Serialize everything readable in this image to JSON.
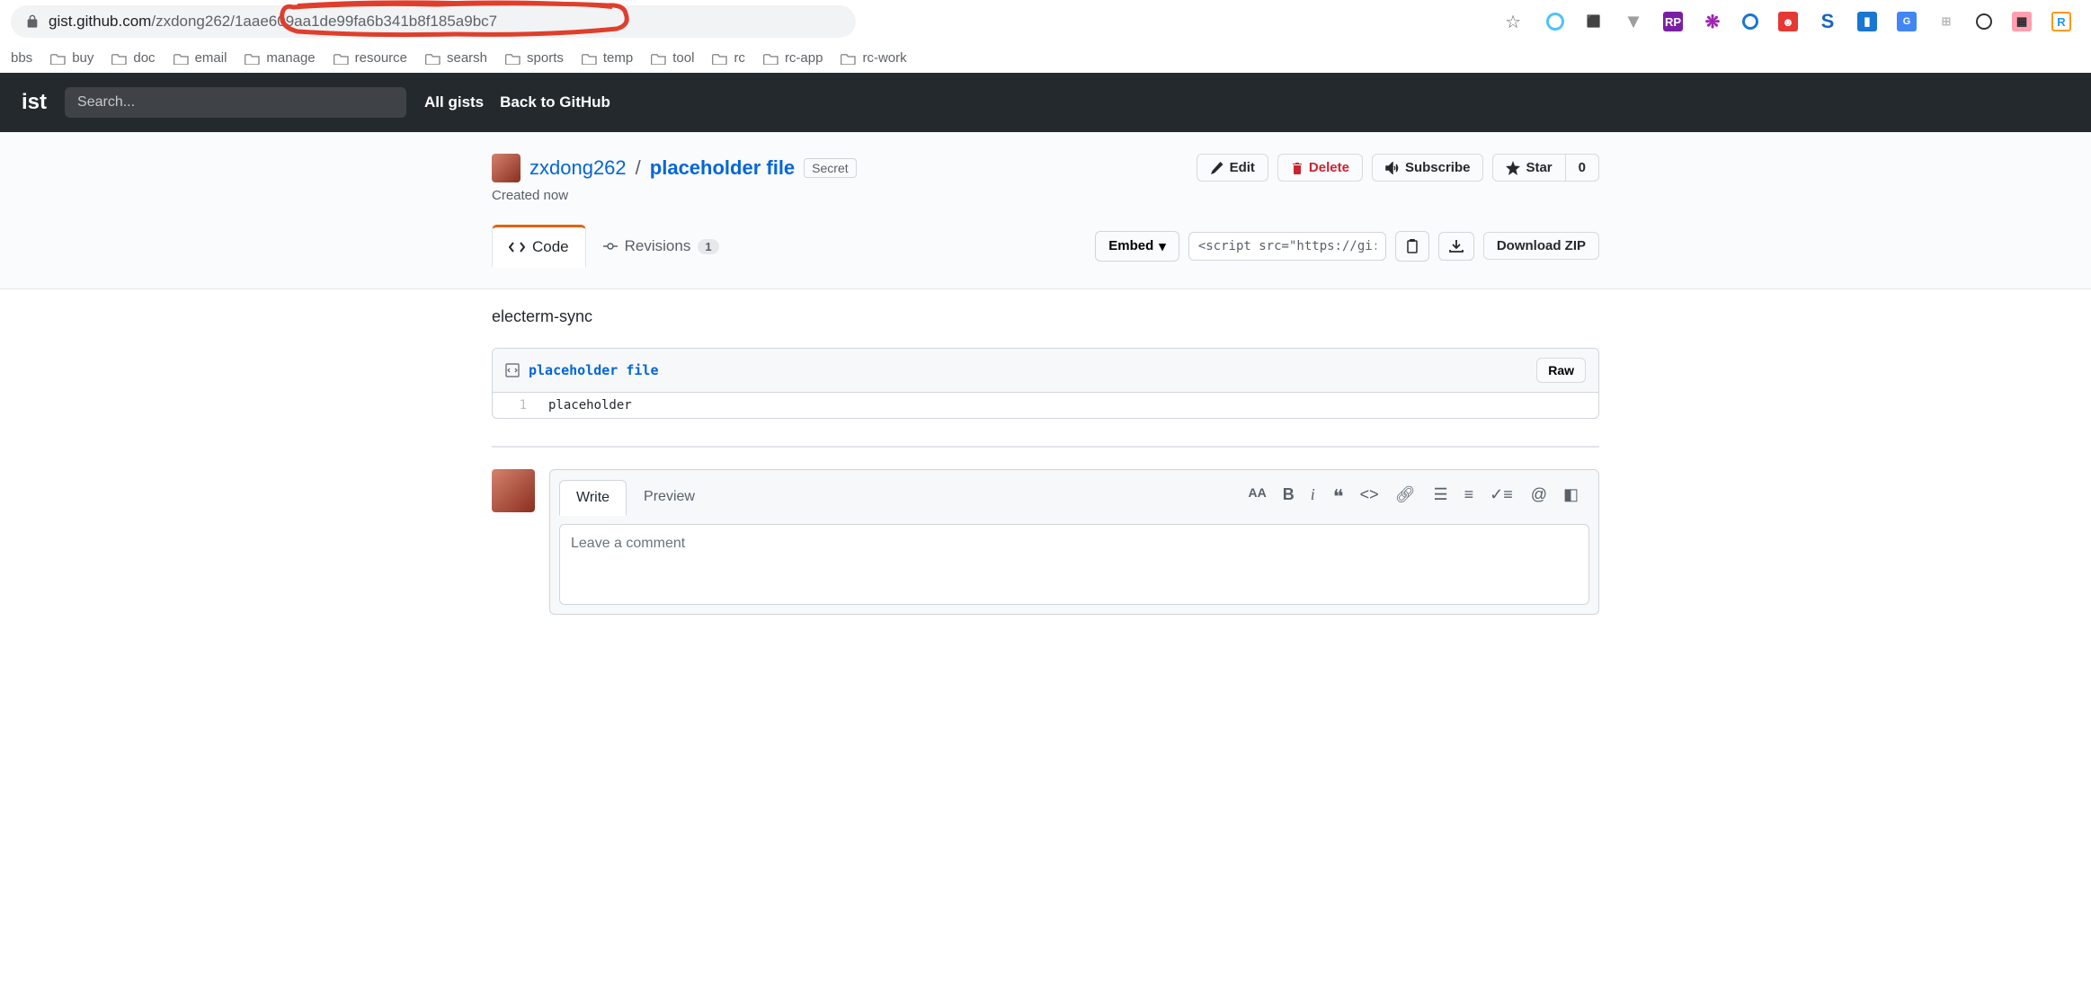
{
  "browser": {
    "url_host": "gist.github.com",
    "url_path": "/zxdong262/1aae609aa1de99fa6b341b8f185a9bc7"
  },
  "bookmarks": [
    "bbs",
    "buy",
    "doc",
    "email",
    "manage",
    "resource",
    "searsh",
    "sports",
    "temp",
    "tool",
    "rc",
    "rc-app",
    "rc-work"
  ],
  "gh_header": {
    "logo": "ist",
    "search_placeholder": "Search...",
    "nav": [
      "All gists",
      "Back to GitHub"
    ]
  },
  "gist": {
    "author": "zxdong262",
    "slash": "/",
    "name": "placeholder file",
    "secret": "Secret",
    "created": "Created now"
  },
  "actions": {
    "edit": "Edit",
    "delete": "Delete",
    "subscribe": "Subscribe",
    "star": "Star",
    "star_count": "0"
  },
  "tabs": {
    "code": "Code",
    "revisions": "Revisions",
    "rev_count": "1"
  },
  "embed": {
    "label": "Embed",
    "script": "<script src=\"https://gi:",
    "download": "Download ZIP"
  },
  "description": "electerm-sync",
  "file": {
    "name": "placeholder file",
    "raw": "Raw",
    "line_num": "1",
    "content": "placeholder"
  },
  "comment": {
    "write": "Write",
    "preview": "Preview",
    "placeholder": "Leave a comment"
  }
}
